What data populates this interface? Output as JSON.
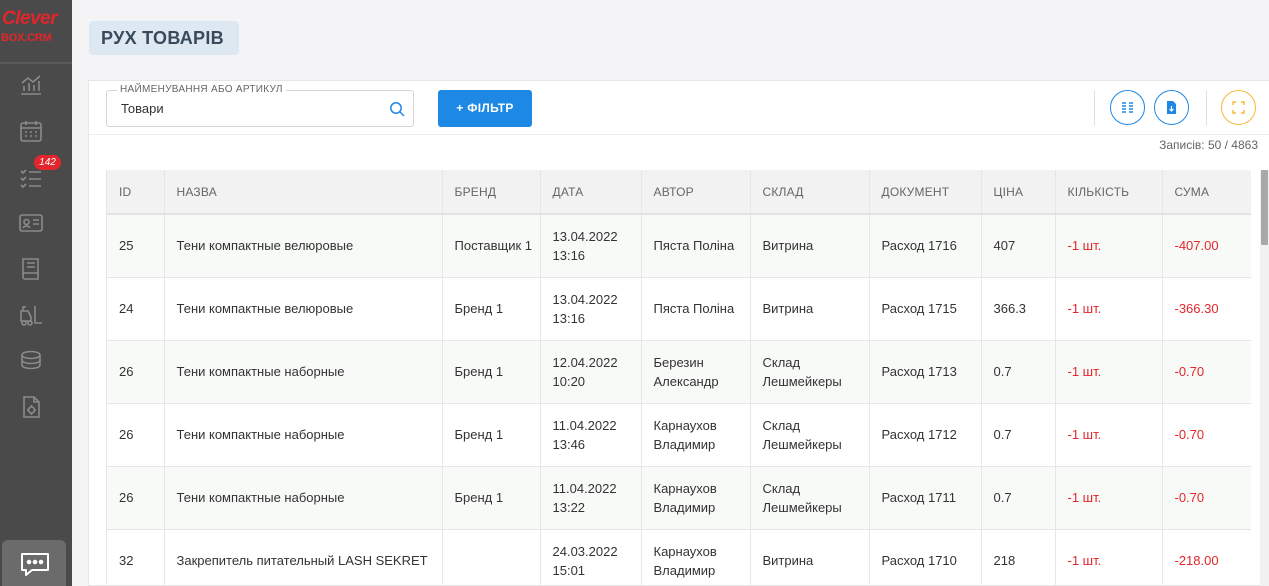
{
  "app": {
    "logo_line1": "Clever",
    "logo_line2": "BOX.CRM"
  },
  "sidebar": {
    "items": [
      {
        "icon": "analytics-icon"
      },
      {
        "icon": "calendar-icon"
      },
      {
        "icon": "tasks-icon",
        "badge": "142"
      },
      {
        "icon": "contacts-card-icon"
      },
      {
        "icon": "catalog-book-icon"
      },
      {
        "icon": "forklift-icon"
      },
      {
        "icon": "coins-icon"
      },
      {
        "icon": "document-settings-icon"
      }
    ],
    "chat_icon": "chat-icon"
  },
  "page": {
    "title": "РУХ ТОВАРІВ"
  },
  "toolbar": {
    "search_label": "НАЙМЕНУВАННЯ АБО АРТИКУЛ",
    "search_value": "Товари",
    "filter_label": "+ ФІЛЬТР",
    "columns_icon": "columns-icon",
    "export_icon": "download-file-icon",
    "fullscreen_icon": "fullscreen-icon"
  },
  "records_text": "Записів: 50 / 4863",
  "colors": {
    "accent": "#1e88e5",
    "negative": "#e3262b",
    "sidebar": "#4a4a4a",
    "fullscreen_border": "#f4b93a"
  },
  "table": {
    "headers": [
      "ID",
      "НАЗВА",
      "БРЕНД",
      "ДАТА",
      "АВТОР",
      "СКЛАД",
      "ДОКУМЕНТ",
      "ЦІНА",
      "КІЛЬКІСТЬ",
      "СУМА"
    ],
    "rows": [
      {
        "id": "25",
        "name": "Тени компактные велюровые",
        "brand": "Поставщик 1",
        "date": "13.04.2022",
        "time": "13:16",
        "author": "Пяста Поліна",
        "warehouse": "Витрина",
        "document": "Расход 1716",
        "price": "407",
        "qty": "-1 шт.",
        "sum": "-407.00"
      },
      {
        "id": "24",
        "name": "Тени компактные велюровые",
        "brand": "Бренд 1",
        "date": "13.04.2022",
        "time": "13:16",
        "author": "Пяста Поліна",
        "warehouse": "Витрина",
        "document": "Расход 1715",
        "price": "366.3",
        "qty": "-1 шт.",
        "sum": "-366.30"
      },
      {
        "id": "26",
        "name": "Тени компактные наборные",
        "brand": "Бренд 1",
        "date": "12.04.2022",
        "time": "10:20",
        "author": "Березин Александр",
        "warehouse": "Склад Лешмейкеры",
        "document": "Расход 1713",
        "price": "0.7",
        "qty": "-1 шт.",
        "sum": "-0.70"
      },
      {
        "id": "26",
        "name": "Тени компактные наборные",
        "brand": "Бренд 1",
        "date": "11.04.2022",
        "time": "13:46",
        "author": "Карнаухов Владимир",
        "warehouse": "Склад Лешмейкеры",
        "document": "Расход 1712",
        "price": "0.7",
        "qty": "-1 шт.",
        "sum": "-0.70"
      },
      {
        "id": "26",
        "name": "Тени компактные наборные",
        "brand": "Бренд 1",
        "date": "11.04.2022",
        "time": "13:22",
        "author": "Карнаухов Владимир",
        "warehouse": "Склад Лешмейкеры",
        "document": "Расход 1711",
        "price": "0.7",
        "qty": "-1 шт.",
        "sum": "-0.70"
      },
      {
        "id": "32",
        "name": "Закрепитель питательный LASH SEKRET",
        "brand": "",
        "date": "24.03.2022",
        "time": "15:01",
        "author": "Карнаухов Владимир",
        "warehouse": "Витрина",
        "document": "Расход 1710",
        "price": "218",
        "qty": "-1 шт.",
        "sum": "-218.00"
      }
    ]
  }
}
